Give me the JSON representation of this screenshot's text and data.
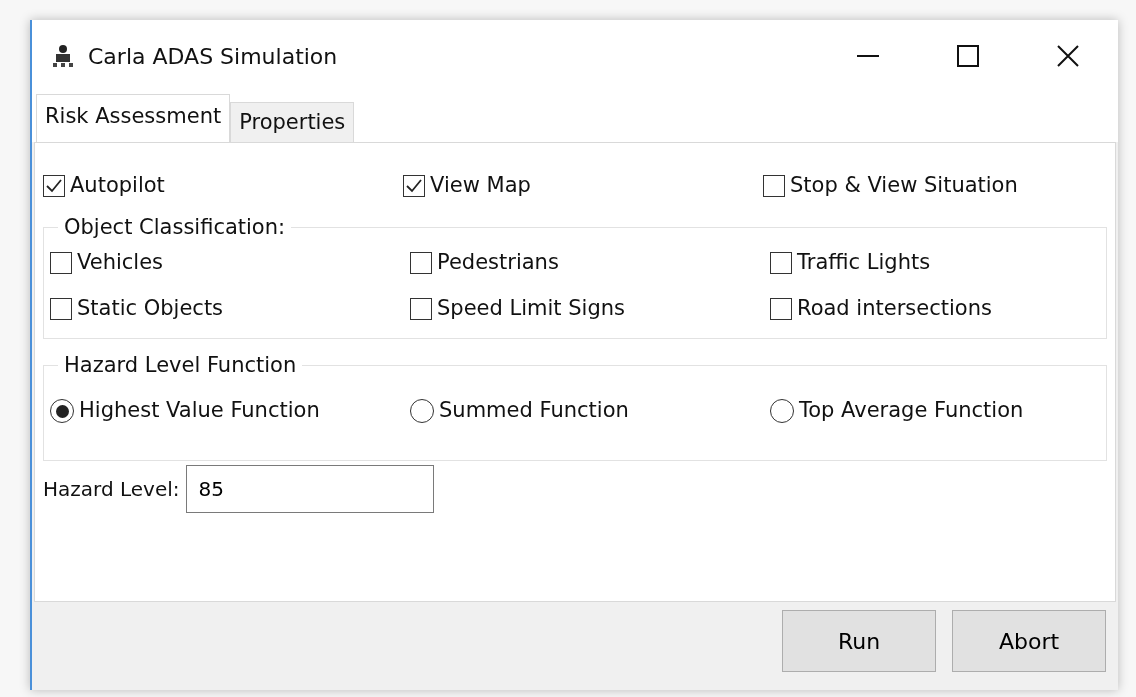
{
  "window": {
    "title": "Carla ADAS Simulation"
  },
  "tabs": [
    {
      "label": "Risk Assessment",
      "selected": true
    },
    {
      "label": "Properties",
      "selected": false
    }
  ],
  "options": [
    {
      "label": "Autopilot",
      "checked": true
    },
    {
      "label": "View Map",
      "checked": true
    },
    {
      "label": "Stop & View Situation",
      "checked": false
    }
  ],
  "object_classification": {
    "title": "Object Classification:",
    "items": [
      {
        "label": "Vehicles",
        "checked": false
      },
      {
        "label": "Pedestrians",
        "checked": false
      },
      {
        "label": "Traffic Lights",
        "checked": false
      },
      {
        "label": "Static Objects",
        "checked": false
      },
      {
        "label": "Speed Limit Signs",
        "checked": false
      },
      {
        "label": "Road intersections",
        "checked": false
      }
    ]
  },
  "hazard_level_function": {
    "title": "Hazard Level Function",
    "options": [
      {
        "label": "Highest Value Function",
        "selected": true
      },
      {
        "label": "Summed Function",
        "selected": false
      },
      {
        "label": "Top Average Function",
        "selected": false
      }
    ]
  },
  "hazard_level": {
    "label": "Hazard Level:",
    "value": "85"
  },
  "buttons": [
    "Run",
    "Abort"
  ]
}
